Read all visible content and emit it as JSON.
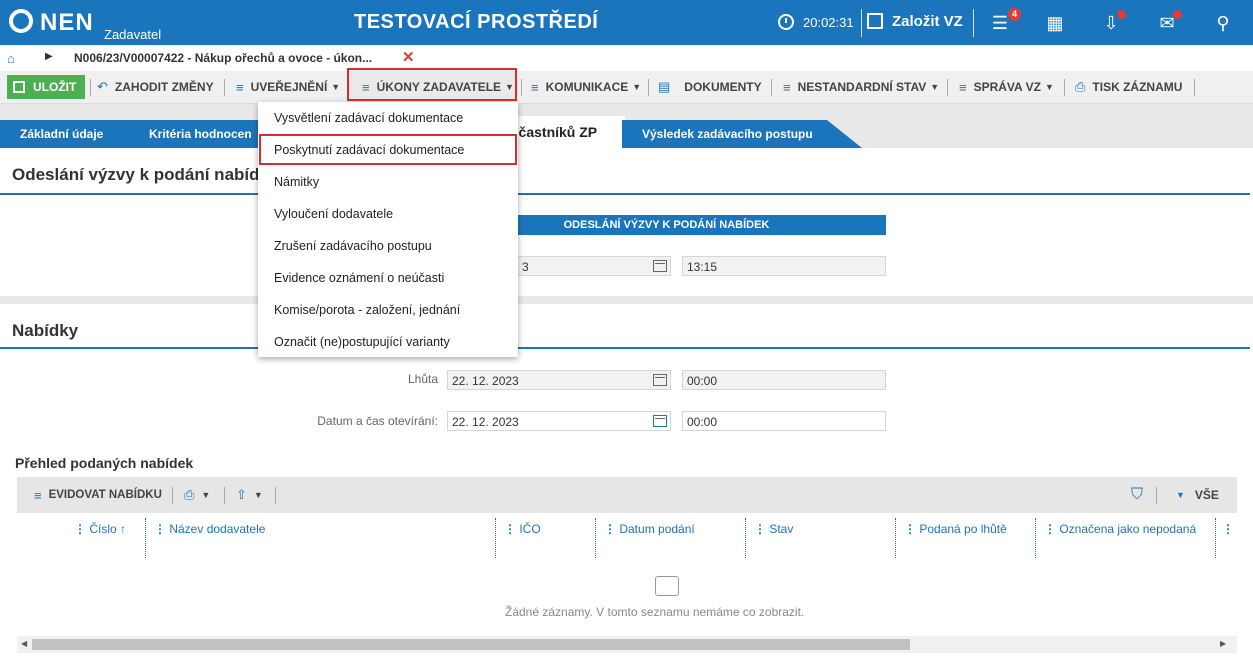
{
  "topbar": {
    "logo": "NEN",
    "logo_sub": "Zadavatel",
    "env_title": "TESTOVACÍ PROSTŘEDÍ",
    "time": "20:02:31",
    "create_label": "Založit VZ",
    "menu_badge": "4"
  },
  "breadcrumb": {
    "path": "N006/23/V00007422 - Nákup ořechů a ovoce - úkon..."
  },
  "toolbar": {
    "save": "ULOŽIT",
    "discard": "ZAHODIT ZMĚNY",
    "publish": "UVEŘEJNĚNÍ",
    "acts": "ÚKONY ZADAVATELE",
    "communication": "KOMUNIKACE",
    "documents": "DOKUMENTY",
    "nonstandard": "NESTANDARDNÍ STAV",
    "admin": "SPRÁVA VZ",
    "print": "TISK ZÁZNAMU"
  },
  "tabs": [
    {
      "label": "Základní údaje"
    },
    {
      "label": "Kritéria hodnocen"
    },
    {
      "label": "účastníků ZP"
    },
    {
      "label": "Výsledek zadávacího postupu"
    }
  ],
  "panel1": {
    "title": "Odeslání výzvy k podání nabíd",
    "section_header": "ODESLÁNÍ VÝZVY K PODÁNÍ NABÍDEK",
    "date_partial": "3",
    "time": "13:15"
  },
  "panel2": {
    "title": "Nabídky",
    "deadline_label": "Lhůta",
    "deadline_date": "22. 12. 2023",
    "deadline_time": "00:00",
    "opening_label": "Datum a čas otevírání:",
    "opening_date": "22. 12. 2023",
    "opening_time": "00:00"
  },
  "grid": {
    "title": "Přehled podaných nabídek",
    "register_btn": "EVIDOVAT NABÍDKU",
    "filter_all": "VŠE",
    "columns": [
      "Číslo",
      "Název dodavatele",
      "IČO",
      "Datum podání",
      "Stav",
      "Podaná po lhůtě",
      "Označena jako nepodaná"
    ],
    "empty": "Žádné záznamy. V tomto seznamu nemáme co zobrazit."
  },
  "dropdown": {
    "items": [
      "Vysvětlení zadávací dokumentace",
      "Poskytnutí zadávací dokumentace",
      "Námitky",
      "Vyloučení dodavatele",
      "Zrušení zadávacího postupu",
      "Evidence oznámení o neúčasti",
      "Komise/porota - založení, jednání",
      "Označit (ne)postupující varianty"
    ]
  }
}
